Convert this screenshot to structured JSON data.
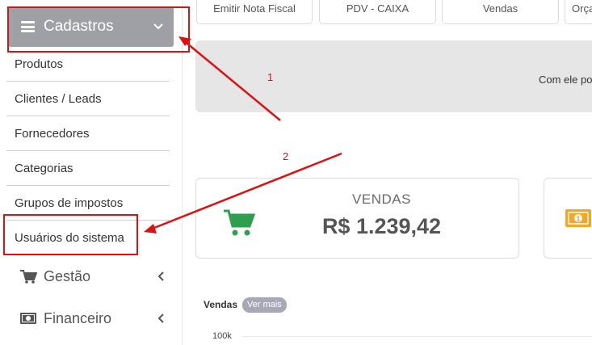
{
  "sidebar": {
    "header": {
      "title": "Cadastros",
      "icon": "bars-icon",
      "expanded_icon": "chevron-down-icon"
    },
    "sub_items": [
      {
        "label": "Produtos"
      },
      {
        "label": "Clientes / Leads"
      },
      {
        "label": "Fornecedores"
      },
      {
        "label": "Categorias"
      },
      {
        "label": "Grupos de impostos"
      },
      {
        "label": "Usuários do sistema"
      }
    ],
    "main_items": [
      {
        "label": "Gestão",
        "icon": "cart-icon",
        "collapsed_icon": "chevron-left-icon"
      },
      {
        "label": "Financeiro",
        "icon": "money-icon",
        "collapsed_icon": "chevron-left-icon"
      }
    ]
  },
  "top_tabs": [
    {
      "label": "Emitir Nota Fiscal"
    },
    {
      "label": "PDV - CAIXA"
    },
    {
      "label": "Vendas"
    },
    {
      "label": "Orça"
    }
  ],
  "banner": {
    "text": "Com ele po"
  },
  "cards": [
    {
      "label": "VENDAS",
      "value": "R$ 1.239,42",
      "icon": "shopping-cart-icon",
      "icon_color": "#2e9e4f"
    },
    {
      "icon": "money-bill-icon",
      "icon_color": "#f5a623"
    }
  ],
  "vendas_chart": {
    "title": "Vendas",
    "ver_mais": "Ver mais",
    "tick_top": "100k"
  },
  "annotations": {
    "step1": "1",
    "step2": "2",
    "color": "#e01010"
  }
}
